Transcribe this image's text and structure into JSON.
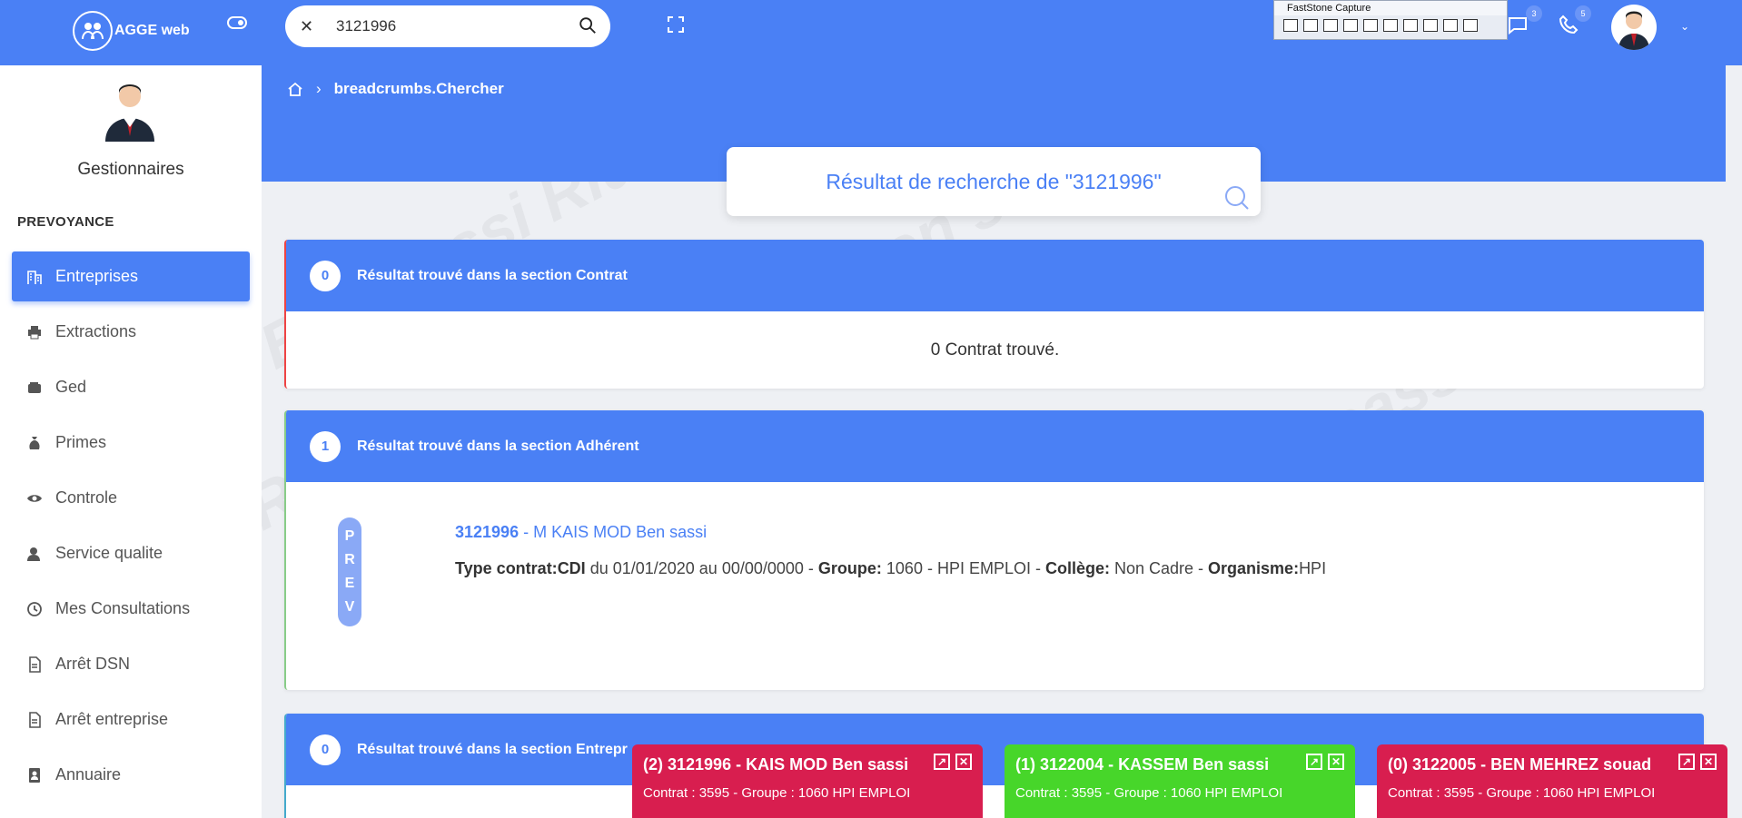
{
  "app": {
    "name": "AGGE web"
  },
  "search": {
    "value": "3121996",
    "clear": "✕"
  },
  "fscapture": {
    "title": "FastStone Capture"
  },
  "notifications": {
    "chat_count": "3",
    "phone_count": "5"
  },
  "sidebar": {
    "role": "Gestionnaires",
    "section": "PREVOYANCE",
    "items": [
      {
        "label": "Entreprises",
        "icon": "building-icon",
        "active": true
      },
      {
        "label": "Extractions",
        "icon": "printer-icon"
      },
      {
        "label": "Ged",
        "icon": "wallet-icon"
      },
      {
        "label": "Primes",
        "icon": "money-bag-icon"
      },
      {
        "label": "Controle",
        "icon": "eye-icon"
      },
      {
        "label": "Service qualite",
        "icon": "user-shield-icon"
      },
      {
        "label": "Mes Consultations",
        "icon": "history-icon"
      },
      {
        "label": "Arrêt DSN",
        "icon": "document-icon"
      },
      {
        "label": "Arrêt entreprise",
        "icon": "document-icon"
      },
      {
        "label": "Annuaire",
        "icon": "address-book-icon"
      }
    ]
  },
  "breadcrumb": {
    "current": "breadcrumbs.Chercher"
  },
  "results": {
    "title": "Résultat de recherche de \"3121996\"",
    "contrat": {
      "count": "0",
      "label": "Résultat trouvé dans la section Contrat",
      "empty": "0 Contrat trouvé."
    },
    "adherent": {
      "count": "1",
      "label": "Résultat trouvé dans la section Adhérent",
      "pill": [
        "P",
        "R",
        "E",
        "V"
      ],
      "id": "3121996",
      "name": " - M KAIS MOD Ben sassi",
      "type_label": "Type contrat:",
      "type_value": "CDI",
      "dates": " du 01/01/2020 au 00/00/0000 - ",
      "groupe_label": "Groupe:",
      "groupe_value": " 1060 - HPI EMPLOI - ",
      "college_label": "Collège:",
      "college_value": " Non Cadre - ",
      "organisme_label": "Organisme:",
      "organisme_value": "HPI"
    },
    "entreprise": {
      "count": "0",
      "label": "Résultat trouvé dans la section Entrepr"
    }
  },
  "popups": [
    {
      "title": "(2) 3121996 - KAIS MOD Ben sassi",
      "sub": "Contrat : 3595 - Groupe : 1060 HPI EMPLOI",
      "color": "#d81e4f"
    },
    {
      "title": "(1) 3122004 - KASSEM Ben sassi",
      "sub": "Contrat : 3595 - Groupe : 1060 HPI EMPLOI",
      "color": "#47d62a"
    },
    {
      "title": "(0) 3122005 - BEN MEHREZ souad",
      "sub": "Contrat : 3595 - Groupe : 1060 HPI EMPLOI",
      "color": "#d81e4f"
    }
  ]
}
